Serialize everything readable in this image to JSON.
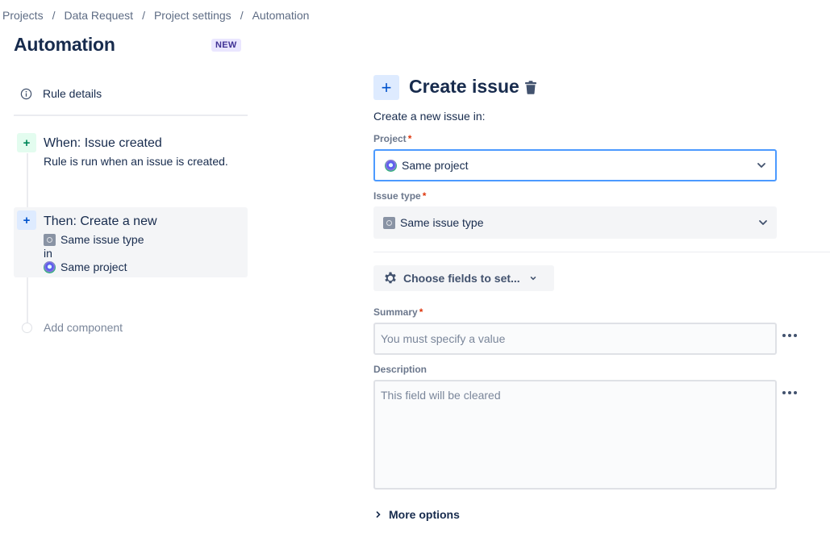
{
  "breadcrumb": [
    "Projects",
    "Data Request",
    "Project settings",
    "Automation"
  ],
  "breadcrumb_separator": "/",
  "page": {
    "title": "Automation",
    "badge": "NEW"
  },
  "rule_panel": {
    "rule_details_label": "Rule details",
    "trigger": {
      "title": "When: Issue created",
      "description": "Rule is run when an issue is created."
    },
    "action": {
      "title": "Then: Create a new",
      "issue_type": "Same issue type",
      "connector": "in",
      "project": "Same project"
    },
    "add_component_label": "Add component"
  },
  "form": {
    "title": "Create issue",
    "subtitle": "Create a new issue in:",
    "project": {
      "label": "Project",
      "required_mark": "*",
      "value": "Same project"
    },
    "issue_type": {
      "label": "Issue type",
      "required_mark": "*",
      "value": "Same issue type"
    },
    "choose_fields_label": "Choose fields to set...",
    "summary": {
      "label": "Summary",
      "required_mark": "*",
      "placeholder": "You must specify a value"
    },
    "description": {
      "label": "Description",
      "placeholder": "This field will be cleared"
    },
    "more_options_label": "More options"
  },
  "colors": {
    "focus_border": "#4c9aff",
    "required": "#de350b",
    "trigger_accent": "#00875a",
    "action_accent": "#0052cc",
    "badge_bg": "#eae6ff",
    "badge_text": "#403294"
  }
}
